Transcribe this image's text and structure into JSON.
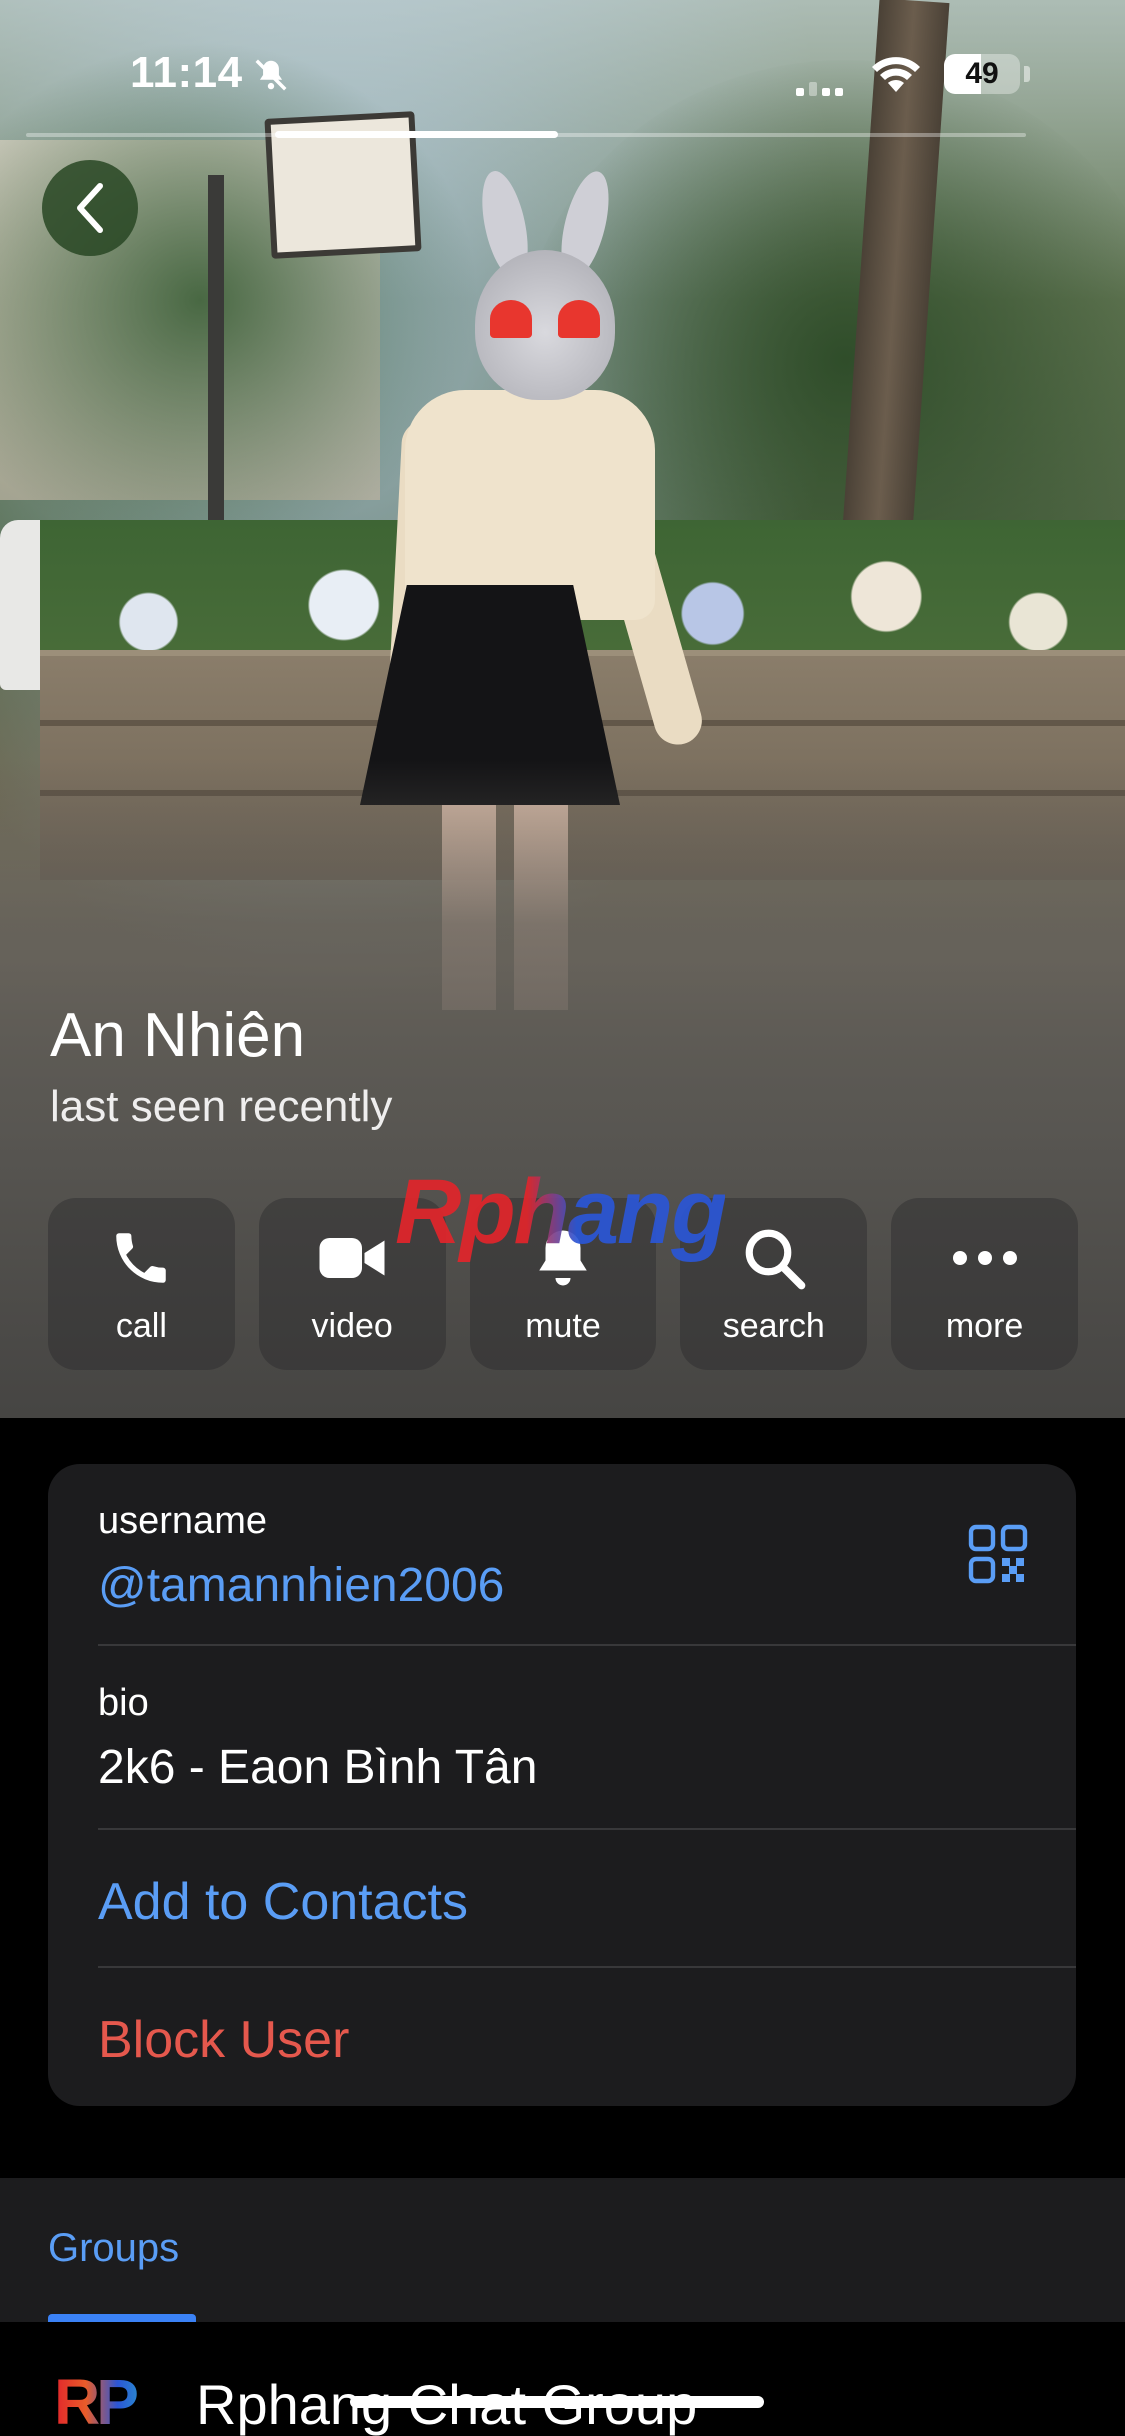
{
  "status_bar": {
    "time": "11:14",
    "battery_percent_text": "49",
    "battery_level": 0.49
  },
  "profile": {
    "name": "An Nhiên",
    "status": "last seen recently"
  },
  "actions": [
    {
      "label": "call",
      "icon": "phone-icon"
    },
    {
      "label": "video",
      "icon": "video-icon"
    },
    {
      "label": "mute",
      "icon": "bell-icon"
    },
    {
      "label": "search",
      "icon": "search-icon"
    },
    {
      "label": "more",
      "icon": "more-icon"
    }
  ],
  "watermark": "Rphang",
  "info": {
    "username_label": "username",
    "username_value": "@tamannhien2006",
    "bio_label": "bio",
    "bio_value": "2k6 - Eaon Bình Tân",
    "add_to_contacts": "Add to Contacts",
    "block_user": "Block User"
  },
  "groups": {
    "tab_label": "Groups",
    "items": [
      {
        "avatar_text": "RP",
        "name": "Rphang Chat Group"
      }
    ]
  },
  "colors": {
    "accent_blue": "#5a9df5",
    "destructive_red": "#e5584d",
    "card_bg": "#1c1c1e"
  }
}
